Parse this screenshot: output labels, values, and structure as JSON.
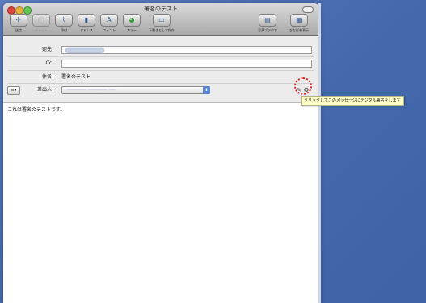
{
  "window": {
    "title": "署名のテスト"
  },
  "toolbar": {
    "buttons": [
      {
        "label": "送信",
        "icon": "paper-plane-icon"
      },
      {
        "label": "チャット",
        "icon": "chat-icon"
      },
      {
        "label": "添付",
        "icon": "paperclip-icon"
      },
      {
        "label": "アドレス",
        "icon": "address-book-icon"
      },
      {
        "label": "フォント",
        "icon": "font-icon"
      },
      {
        "label": "カラー",
        "icon": "color-wheel-icon"
      },
      {
        "label": "下書きとして保存",
        "icon": "draft-icon"
      },
      {
        "label": "写真ブラウザ",
        "icon": "photo-browser-icon"
      },
      {
        "label": "ひな形を表示",
        "icon": "stationery-icon"
      }
    ]
  },
  "header": {
    "to_label": "宛先：",
    "cc_label": "Cc：",
    "subject_label": "件名：",
    "subject_value": "署名のテスト",
    "from_label": "差出人：",
    "account_button": "≡▾"
  },
  "tooltip": {
    "text": "クリックしてこのメッセージにデジタル署名をします"
  },
  "message": {
    "body": "これは署名のテストです。"
  },
  "colors": {
    "desktop": "#4a6fb0",
    "highlight": "#e0201e",
    "tooltip_bg": "#ffffc8"
  }
}
